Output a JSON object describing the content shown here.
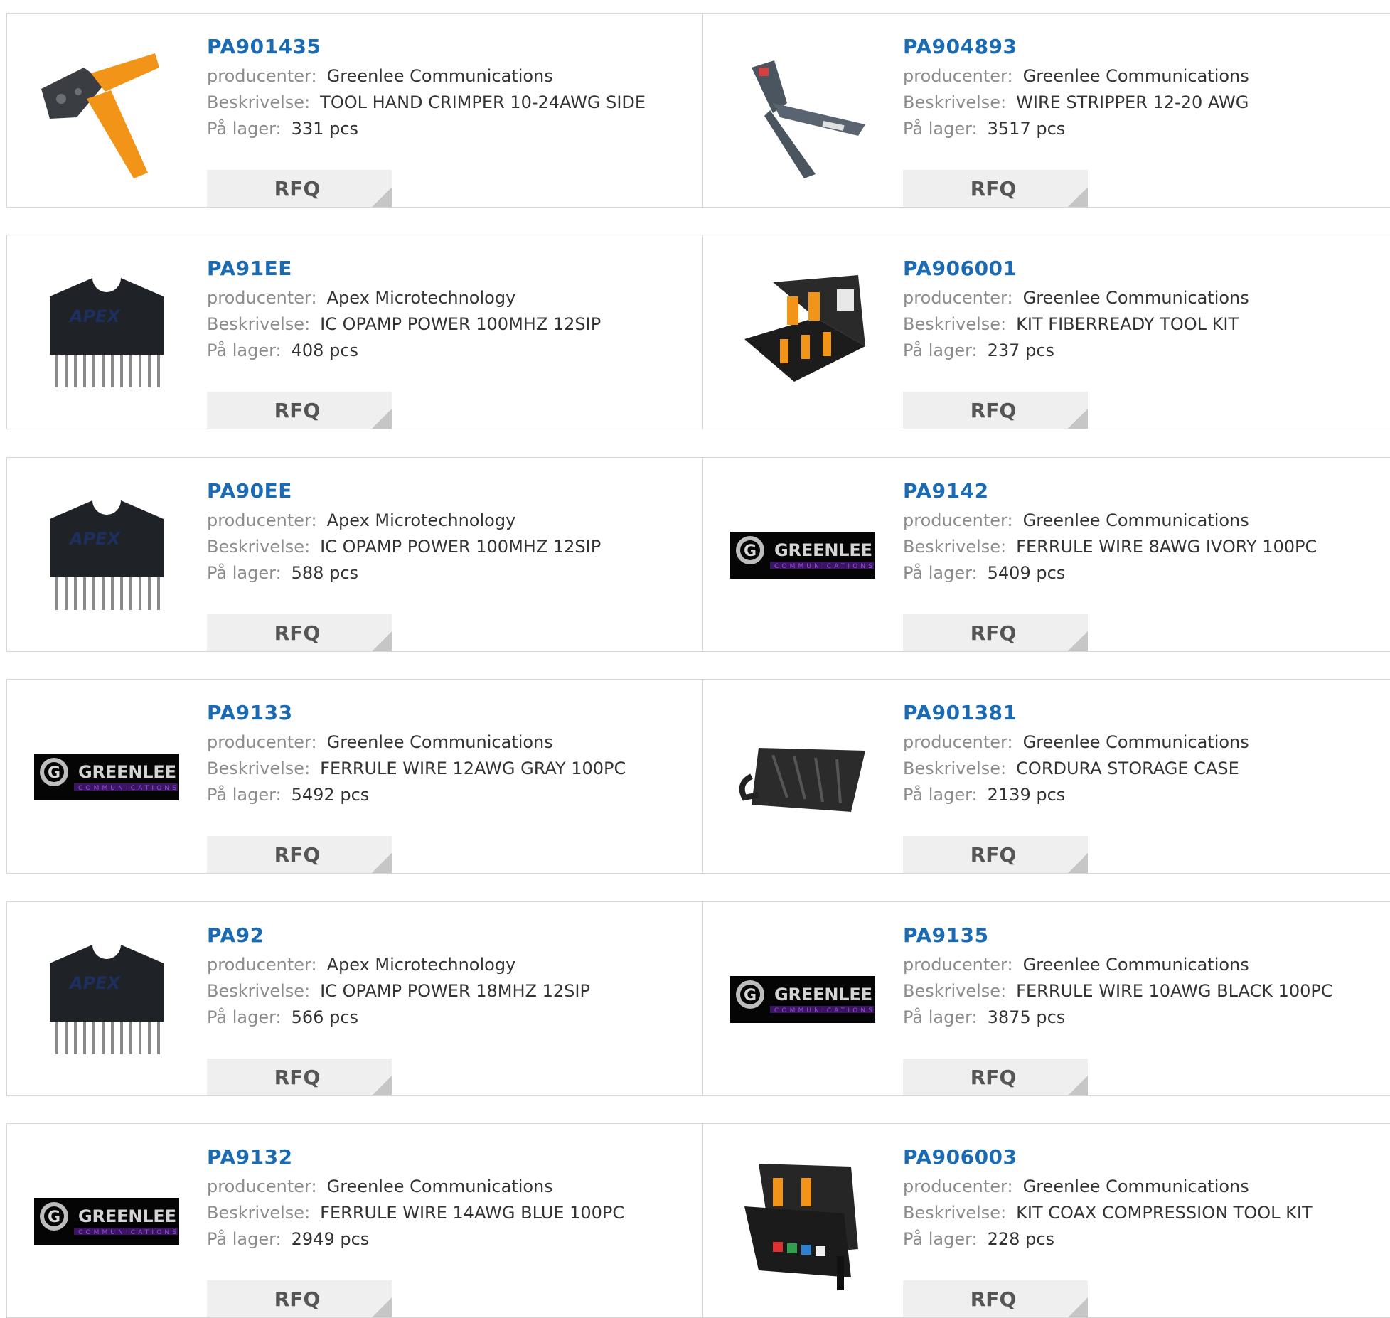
{
  "labels": {
    "manufacturer": "producenter:",
    "description": "Beskrivelse:",
    "stock": "På lager:",
    "rfq": "RFQ"
  },
  "products": [
    {
      "part": "PA901435",
      "manufacturer": "Greenlee Communications",
      "description": "TOOL HAND CRIMPER 10-24AWG SIDE",
      "stock": "331 pcs",
      "image": "crimper"
    },
    {
      "part": "PA904893",
      "manufacturer": "Greenlee Communications",
      "description": "WIRE STRIPPER 12-20 AWG",
      "stock": "3517 pcs",
      "image": "stripper"
    },
    {
      "part": "PA91EE",
      "manufacturer": "Apex Microtechnology",
      "description": "IC OPAMP POWER 100MHZ 12SIP",
      "stock": "408 pcs",
      "image": "apex"
    },
    {
      "part": "PA906001",
      "manufacturer": "Greenlee Communications",
      "description": "KIT FIBERREADY TOOL KIT",
      "stock": "237 pcs",
      "image": "kitcase"
    },
    {
      "part": "PA90EE",
      "manufacturer": "Apex Microtechnology",
      "description": "IC OPAMP POWER 100MHZ 12SIP",
      "stock": "588 pcs",
      "image": "apex"
    },
    {
      "part": "PA9142",
      "manufacturer": "Greenlee Communications",
      "description": "FERRULE WIRE 8AWG IVORY 100PC",
      "stock": "5409 pcs",
      "image": "greenlee"
    },
    {
      "part": "PA9133",
      "manufacturer": "Greenlee Communications",
      "description": "FERRULE WIRE 12AWG GRAY 100PC",
      "stock": "5492 pcs",
      "image": "greenlee"
    },
    {
      "part": "PA901381",
      "manufacturer": "Greenlee Communications",
      "description": "CORDURA STORAGE CASE",
      "stock": "2139 pcs",
      "image": "pouch"
    },
    {
      "part": "PA92",
      "manufacturer": "Apex Microtechnology",
      "description": "IC OPAMP POWER 18MHZ 12SIP",
      "stock": "566 pcs",
      "image": "apex"
    },
    {
      "part": "PA9135",
      "manufacturer": "Greenlee Communications",
      "description": "FERRULE WIRE 10AWG BLACK 100PC",
      "stock": "3875 pcs",
      "image": "greenlee"
    },
    {
      "part": "PA9132",
      "manufacturer": "Greenlee Communications",
      "description": "FERRULE WIRE 14AWG BLUE 100PC",
      "stock": "2949 pcs",
      "image": "greenlee"
    },
    {
      "part": "PA906003",
      "manufacturer": "Greenlee Communications",
      "description": "KIT COAX COMPRESSION TOOL KIT",
      "stock": "228 pcs",
      "image": "coaxkit"
    }
  ],
  "logo_text": {
    "greenlee": "GREENLEE",
    "communications": "COMMUNICATIONS",
    "apex": "APEX"
  }
}
